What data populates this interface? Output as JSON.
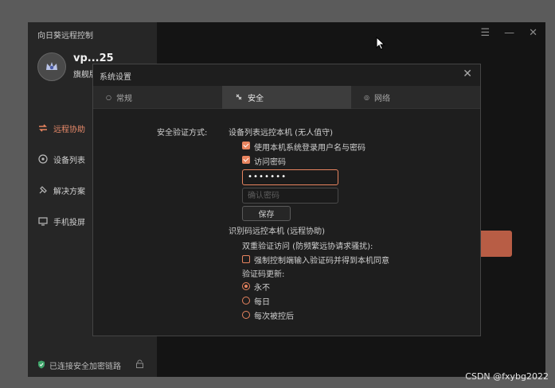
{
  "app": {
    "title": "向日葵远程控制",
    "user": {
      "name": "vp...25",
      "badge": "旗舰版"
    }
  },
  "sidebar": {
    "items": [
      {
        "label": "远程协助",
        "icon": "remote-assist-icon",
        "active": true
      },
      {
        "label": "设备列表",
        "icon": "device-list-icon",
        "active": false
      },
      {
        "label": "解决方案",
        "icon": "solution-icon",
        "active": false
      },
      {
        "label": "手机投屏",
        "icon": "screen-cast-icon",
        "active": false
      }
    ],
    "status": "已连接安全加密链路"
  },
  "window_controls": {
    "menu": "☰",
    "minimize": "—",
    "close": "✕"
  },
  "dialog": {
    "title": "系统设置",
    "close": "✕",
    "tabs": [
      {
        "label": "常规",
        "active": false
      },
      {
        "label": "安全",
        "active": true
      },
      {
        "label": "网络",
        "active": false
      }
    ],
    "security": {
      "verify_method_label": "安全验证方式:",
      "device_list_section": "设备列表远控本机 (无人值守)",
      "use_system_login": {
        "label": "使用本机系统登录用户名与密码",
        "checked": true
      },
      "access_password": {
        "label": "访问密码",
        "checked": true
      },
      "password_value": "•••••••",
      "confirm_placeholder": "确认密码",
      "save_label": "保存",
      "recog_section": "识别码远控本机 (远程协助)",
      "two_factor_label": "双重验证访问 (防频繁远协请求骚扰):",
      "force_verify": {
        "label": "强制控制端输入验证码并得到本机同意",
        "checked": false
      },
      "code_update_label": "验证码更新:",
      "code_update_options": [
        {
          "label": "永不",
          "selected": true
        },
        {
          "label": "每日",
          "selected": false
        },
        {
          "label": "每次被控后",
          "selected": false
        }
      ]
    }
  },
  "watermark": "CSDN @fxybg2022",
  "colors": {
    "accent": "#e8845f",
    "app_bg": "#161616",
    "sidebar_bg": "#262626",
    "dialog_bg": "#1e1e1e",
    "outer_bg": "#5b5b5b"
  }
}
